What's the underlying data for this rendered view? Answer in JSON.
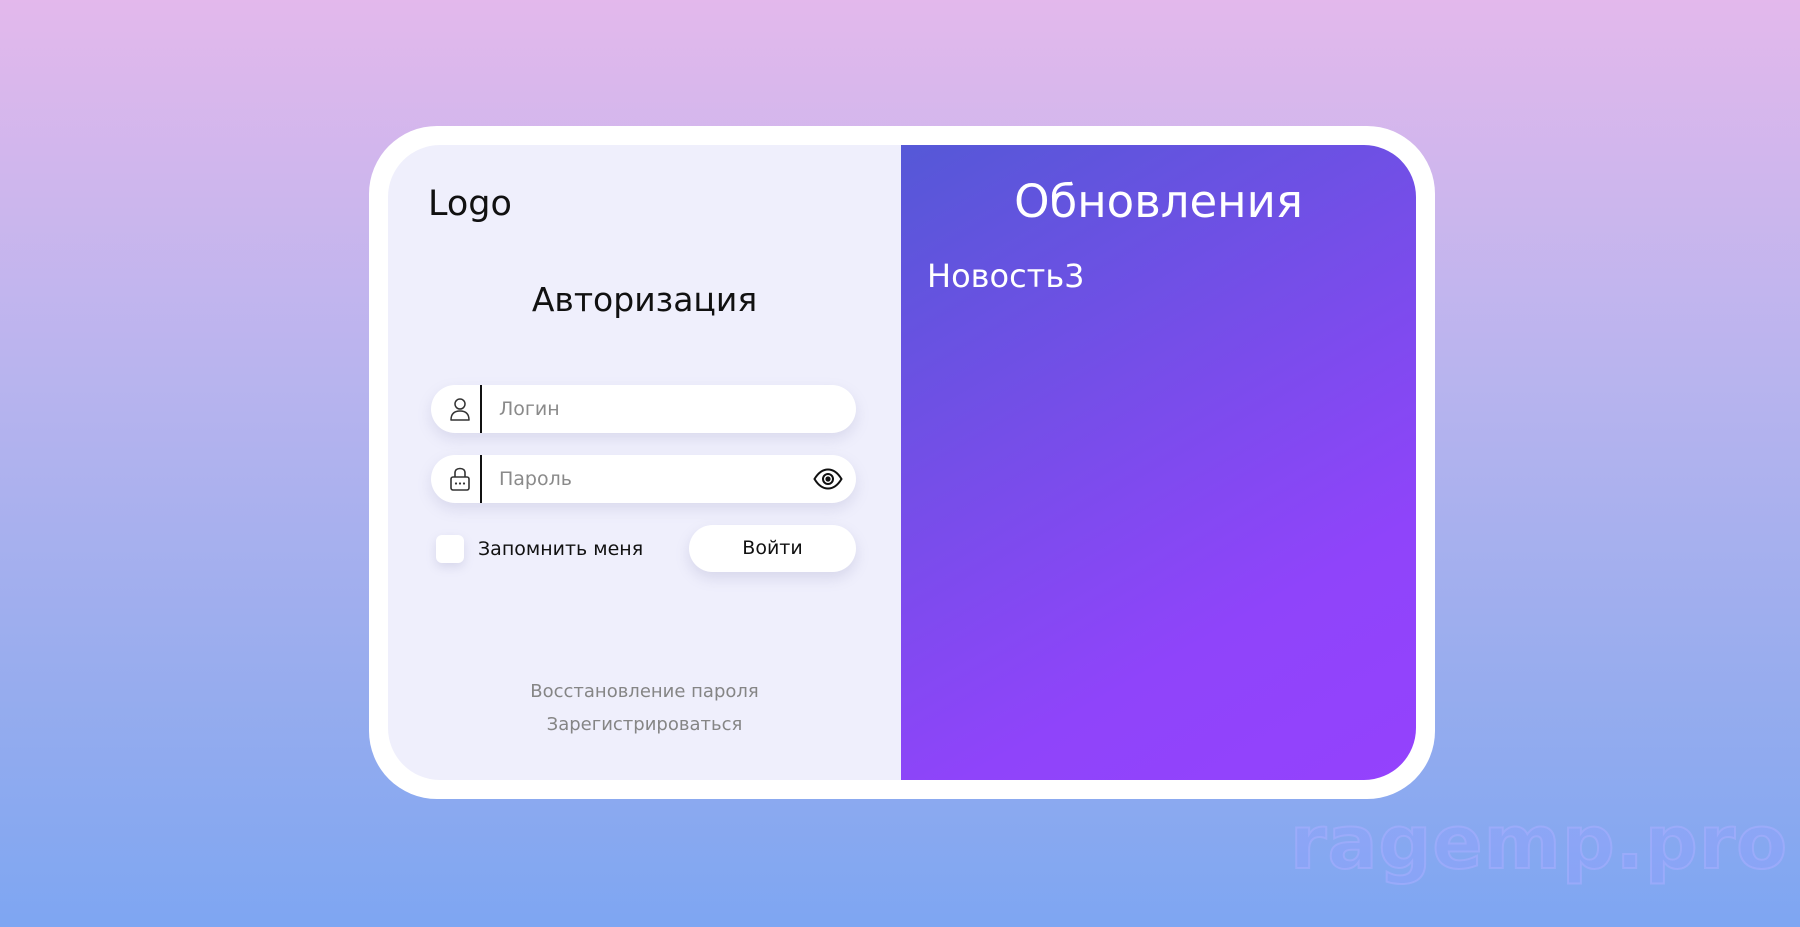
{
  "login_panel": {
    "logo": "Logo",
    "title": "Авторизация",
    "login_field": {
      "placeholder": "Логин",
      "icon": "user-icon"
    },
    "password_field": {
      "placeholder": "Пароль",
      "icon": "lock-icon",
      "toggle_icon": "eye-icon"
    },
    "remember_label": "Запомнить меня",
    "remember_checked": false,
    "submit_label": "Войти",
    "recover_link": "Восстановление пароля",
    "register_link": "Зарегистрироваться"
  },
  "updates_panel": {
    "title": "Обновления",
    "news": [
      "Новость3"
    ]
  },
  "watermark": "ragemp.pro",
  "colors": {
    "left_bg": "#efeffc",
    "right_gradient_start": "#5558d7",
    "right_gradient_end": "#9442fd"
  }
}
